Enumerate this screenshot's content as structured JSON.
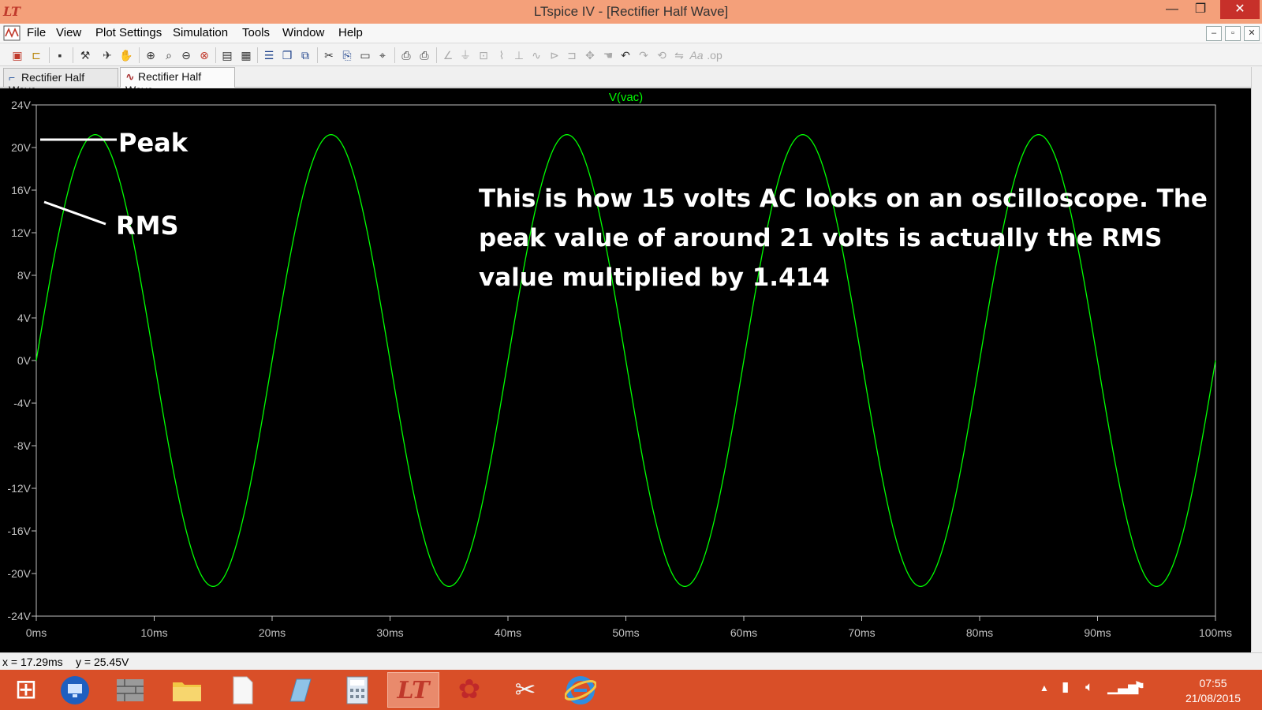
{
  "window": {
    "title": "LTspice IV - [Rectifier Half Wave]",
    "app_icon": "LT",
    "minimize_glyph": "—",
    "maximize_glyph": "❐",
    "close_glyph": "✕"
  },
  "menu": {
    "items": [
      "File",
      "View",
      "Plot Settings",
      "Simulation",
      "Tools",
      "Window",
      "Help"
    ],
    "mdi_buttons": [
      "–",
      "▫",
      "✕"
    ]
  },
  "tabs": [
    {
      "label": "Rectifier Half Wave",
      "icon": "schematic-icon",
      "active": false
    },
    {
      "label": "Rectifier Half Wave",
      "icon": "waveform-icon",
      "active": true
    }
  ],
  "chart_data": {
    "type": "line",
    "series": [
      {
        "name": "V(vac)",
        "color": "#00ff00"
      }
    ],
    "function": "21.21 * sin(2*pi*50*t)",
    "amplitude_v": 21.21,
    "frequency_hz": 50,
    "xlim_ms": [
      0,
      100
    ],
    "ylim_v": [
      -24,
      24
    ],
    "x_ticks": [
      "0ms",
      "10ms",
      "20ms",
      "30ms",
      "40ms",
      "50ms",
      "60ms",
      "70ms",
      "80ms",
      "90ms",
      "100ms"
    ],
    "y_ticks": [
      "24V",
      "20V",
      "16V",
      "12V",
      "8V",
      "4V",
      "0V",
      "-4V",
      "-8V",
      "-12V",
      "-16V",
      "-20V",
      "-24V"
    ],
    "background": "#000000",
    "axis_color": "#c0c0c0"
  },
  "annotations": {
    "peak": "Peak",
    "rms": "RMS",
    "note": "This is how 15 volts AC looks on an oscilloscope. The peak value of around 21 volts is actually the RMS value multiplied by 1.414"
  },
  "status": {
    "x": "x = 17.29ms",
    "y": "y = 25.45V"
  },
  "taskbar": {
    "time": "07:55",
    "date": "21/08/2015"
  }
}
